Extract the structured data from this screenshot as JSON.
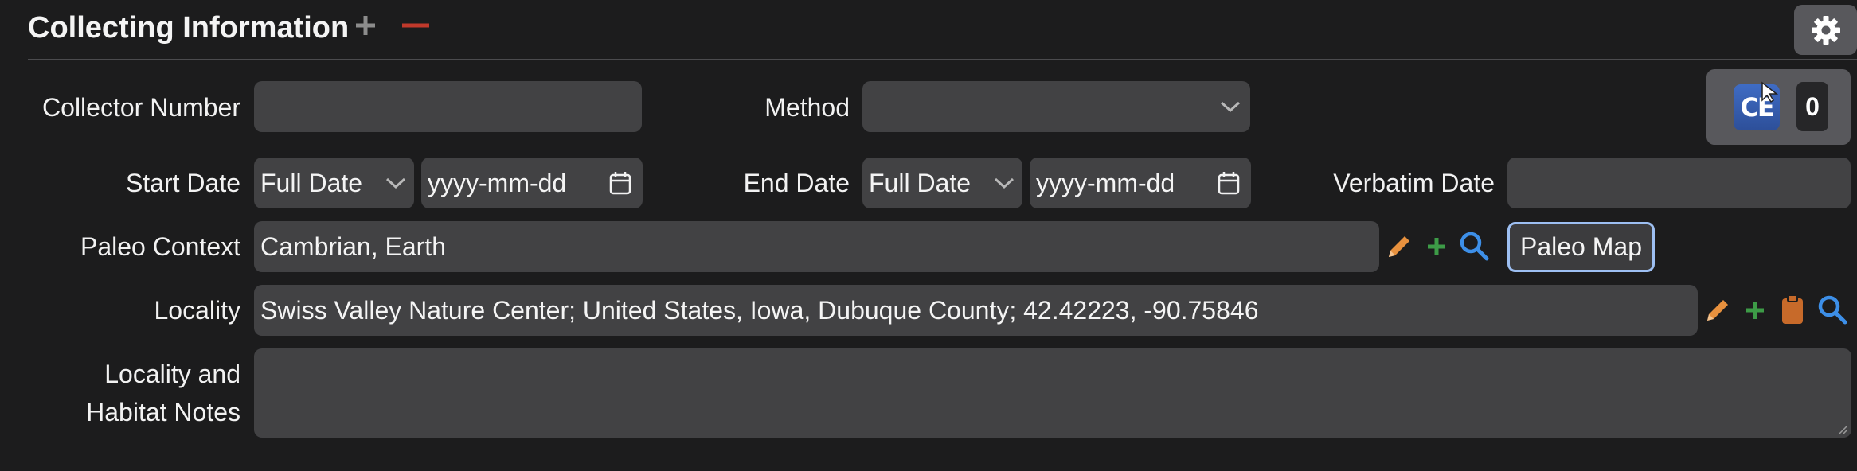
{
  "header": {
    "title": "Collecting Information",
    "add_icon": "plus-icon",
    "remove_icon": "minus-icon",
    "settings_icon": "gear-icon"
  },
  "collector_number": {
    "label": "Collector Number",
    "value": ""
  },
  "method": {
    "label": "Method",
    "value": ""
  },
  "start_date": {
    "label": "Start Date",
    "precision": "Full Date",
    "placeholder": "yyyy-mm-dd"
  },
  "end_date": {
    "label": "End Date",
    "precision": "Full Date",
    "placeholder": "yyyy-mm-dd"
  },
  "verbatim_date": {
    "label": "Verbatim Date",
    "value": ""
  },
  "paleo_context": {
    "label": "Paleo Context",
    "value": "Cambrian, Earth",
    "map_button": "Paleo Map"
  },
  "locality": {
    "label": "Locality",
    "value": "Swiss Valley Nature Center; United States, Iowa, Dubuque County; 42.42223, -90.75846"
  },
  "habitat_notes": {
    "label_line1": "Locality and",
    "label_line2": "Habitat Notes",
    "value": ""
  },
  "ce_widget": {
    "logo_text": "CE",
    "count": "0"
  },
  "colors": {
    "background": "#1c1c1d",
    "field": "#424244",
    "edit": "#e8913e",
    "add": "#3d9b47",
    "search": "#3d8fe8",
    "remove": "#c0392b",
    "clipboard": "#c76a2a"
  }
}
